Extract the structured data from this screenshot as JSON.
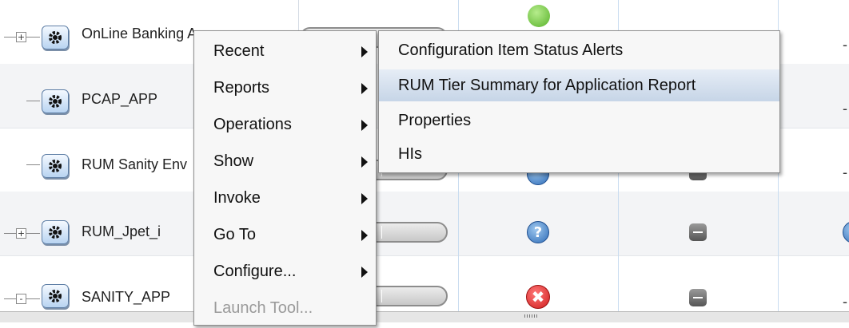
{
  "rows": [
    {
      "expander": "+",
      "name": "OnLine Banking App"
    },
    {
      "expander": "",
      "name": "PCAP_APP"
    },
    {
      "expander": "",
      "name": "RUM Sanity Env"
    },
    {
      "expander": "+",
      "name": "RUM_Jpet_i"
    },
    {
      "expander": "-",
      "name": "SANITY_APP"
    }
  ],
  "dash_text": "-",
  "context_menu": {
    "items": [
      {
        "label": "Recent",
        "submenu": true
      },
      {
        "label": "Reports",
        "submenu": true
      },
      {
        "label": "Operations",
        "submenu": true
      },
      {
        "label": "Show",
        "submenu": true
      },
      {
        "label": "Invoke",
        "submenu": true
      },
      {
        "label": "Go To",
        "submenu": true
      },
      {
        "label": "Configure...",
        "submenu": true
      },
      {
        "label": "Launch Tool...",
        "submenu": false,
        "disabled": true
      }
    ]
  },
  "recent_submenu": {
    "items": [
      {
        "label": "Configuration Item Status Alerts"
      },
      {
        "label": "RUM Tier Summary for Application Report",
        "highlighted": true
      },
      {
        "label": "Properties"
      },
      {
        "label": "HIs"
      }
    ]
  },
  "status_icons": {
    "question": "?",
    "error": "✖"
  },
  "colors": {
    "highlight": "#c6d5e7",
    "row_alt": "#f3f4f6",
    "error_red": "#d01c1c",
    "help_blue": "#2f6db8"
  }
}
